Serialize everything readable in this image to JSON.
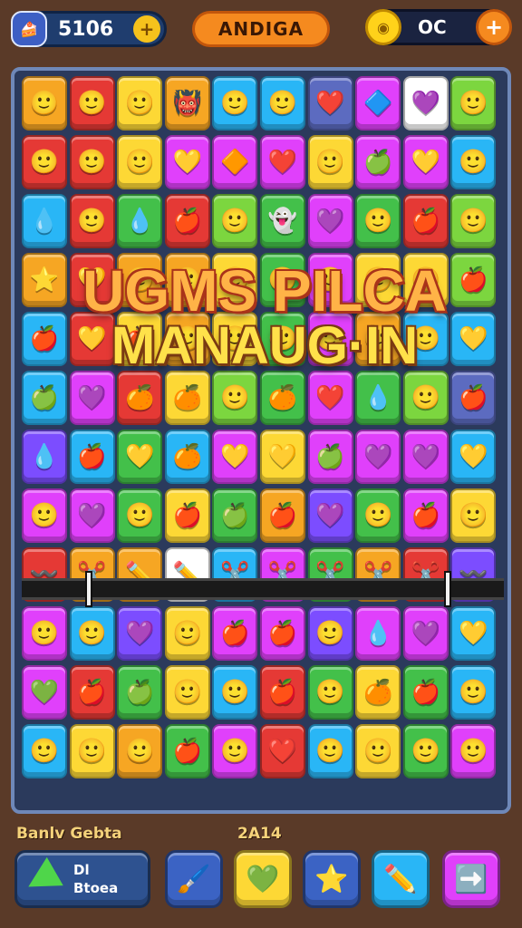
{
  "header": {
    "coins_value": "5106",
    "title_label": "ANDIGA",
    "lives_value": "OC",
    "coin_plus_label": "+",
    "lives_plus_label": "+"
  },
  "banner": {
    "line1": "UGMS PILCA",
    "line2": "MANAUG·IN"
  },
  "board": {
    "rows": [
      [
        [
          "#f6a623",
          "🙂"
        ],
        [
          "#e53935",
          "🙂"
        ],
        [
          "#fdd835",
          "🙂"
        ],
        [
          "#f6a623",
          "👹"
        ],
        [
          "#29b6f6",
          "🙂"
        ],
        [
          "#29b6f6",
          "🙂"
        ],
        [
          "#5c6bc0",
          "❤️"
        ],
        [
          "#e040fb",
          "🔷"
        ],
        [
          "#ffffff",
          "💜"
        ],
        [
          "#7cd63f",
          "🙂"
        ]
      ],
      [
        [
          "#e53935",
          "🙂"
        ],
        [
          "#e53935",
          "🙂"
        ],
        [
          "#fdd835",
          "🙂"
        ],
        [
          "#e040fb",
          "💛"
        ],
        [
          "#e040fb",
          "🔶"
        ],
        [
          "#e040fb",
          "❤️"
        ],
        [
          "#fdd835",
          "🙂"
        ],
        [
          "#e040fb",
          "🍏"
        ],
        [
          "#e040fb",
          "💛"
        ],
        [
          "#29b6f6",
          "🙂"
        ]
      ],
      [
        [
          "#29b6f6",
          "💧"
        ],
        [
          "#e53935",
          "🙂"
        ],
        [
          "#43c04a",
          "💧"
        ],
        [
          "#e53935",
          "🍎"
        ],
        [
          "#7cd63f",
          "🙂"
        ],
        [
          "#43c04a",
          "👻"
        ],
        [
          "#e040fb",
          "💜"
        ],
        [
          "#43c04a",
          "🙂"
        ],
        [
          "#e53935",
          "🍎"
        ],
        [
          "#7cd63f",
          "🙂"
        ]
      ],
      [
        [
          "#f6a623",
          "⭐"
        ],
        [
          "#e53935",
          "💛"
        ],
        [
          "#f6a623",
          "🙂"
        ],
        [
          "#f6a623",
          "🙂"
        ],
        [
          "#fdd835",
          "🙂"
        ],
        [
          "#43c04a",
          "🙂"
        ],
        [
          "#e040fb",
          "🙂"
        ],
        [
          "#fdd835",
          "🙂"
        ],
        [
          "#fdd835",
          "🙂"
        ],
        [
          "#7cd63f",
          "🍎"
        ]
      ],
      [
        [
          "#29b6f6",
          "🍎"
        ],
        [
          "#e53935",
          "💛"
        ],
        [
          "#fdd835",
          "🍎"
        ],
        [
          "#f6a623",
          "🙂"
        ],
        [
          "#fdd835",
          "🙂"
        ],
        [
          "#43c04a",
          "🙂"
        ],
        [
          "#e040fb",
          "🙂"
        ],
        [
          "#f6a623",
          "🙂"
        ],
        [
          "#29b6f6",
          "🙂"
        ],
        [
          "#29b6f6",
          "💛"
        ]
      ],
      [
        [
          "#29b6f6",
          "🍏"
        ],
        [
          "#e040fb",
          "💜"
        ],
        [
          "#e53935",
          "🍊"
        ],
        [
          "#fdd835",
          "🍊"
        ],
        [
          "#7cd63f",
          "🙂"
        ],
        [
          "#43c04a",
          "🍊"
        ],
        [
          "#e040fb",
          "❤️"
        ],
        [
          "#43c04a",
          "💧"
        ],
        [
          "#7cd63f",
          "🙂"
        ],
        [
          "#5c6bc0",
          "🍎"
        ]
      ],
      [
        [
          "#7c4dff",
          "💧"
        ],
        [
          "#29b6f6",
          "🍎"
        ],
        [
          "#43c04a",
          "💛"
        ],
        [
          "#29b6f6",
          "🍊"
        ],
        [
          "#e040fb",
          "💛"
        ],
        [
          "#fdd835",
          "💛"
        ],
        [
          "#e040fb",
          "🍏"
        ],
        [
          "#e040fb",
          "💜"
        ],
        [
          "#e040fb",
          "💜"
        ],
        [
          "#29b6f6",
          "💛"
        ]
      ],
      [
        [
          "#e040fb",
          "🙂"
        ],
        [
          "#e040fb",
          "💜"
        ],
        [
          "#43c04a",
          "🙂"
        ],
        [
          "#fdd835",
          "🍎"
        ],
        [
          "#43c04a",
          "🍏"
        ],
        [
          "#f6a623",
          "🍎"
        ],
        [
          "#7c4dff",
          "💜"
        ],
        [
          "#43c04a",
          "🙂"
        ],
        [
          "#e040fb",
          "🍎"
        ],
        [
          "#fdd835",
          "🙂"
        ]
      ],
      [
        [
          "#e53935",
          "〰️"
        ],
        [
          "#f6a623",
          "✂️"
        ],
        [
          "#f6a623",
          "✏️"
        ],
        [
          "#ffffff",
          "✏️"
        ],
        [
          "#29b6f6",
          "✂️"
        ],
        [
          "#e040fb",
          "✂️"
        ],
        [
          "#43c04a",
          "✂️"
        ],
        [
          "#f6a623",
          "✂️"
        ],
        [
          "#e53935",
          "✂️"
        ],
        [
          "#7c4dff",
          "〰️"
        ]
      ],
      [
        [
          "#e040fb",
          "🙂"
        ],
        [
          "#29b6f6",
          "🙂"
        ],
        [
          "#7c4dff",
          "💜"
        ],
        [
          "#fdd835",
          "🙂"
        ],
        [
          "#e040fb",
          "🍎"
        ],
        [
          "#e040fb",
          "🍎"
        ],
        [
          "#7c4dff",
          "🙂"
        ],
        [
          "#e040fb",
          "💧"
        ],
        [
          "#e040fb",
          "💜"
        ],
        [
          "#29b6f6",
          "💛"
        ]
      ],
      [
        [
          "#e040fb",
          "💚"
        ],
        [
          "#e53935",
          "🍎"
        ],
        [
          "#43c04a",
          "🍏"
        ],
        [
          "#fdd835",
          "🙂"
        ],
        [
          "#29b6f6",
          "🙂"
        ],
        [
          "#e53935",
          "🍎"
        ],
        [
          "#43c04a",
          "🙂"
        ],
        [
          "#fdd835",
          "🍊"
        ],
        [
          "#43c04a",
          "🍎"
        ],
        [
          "#29b6f6",
          "🙂"
        ]
      ],
      [
        [
          "#29b6f6",
          "🙂"
        ],
        [
          "#fdd835",
          "🙂"
        ],
        [
          "#f6a623",
          "🙂"
        ],
        [
          "#43c04a",
          "🍎"
        ],
        [
          "#e040fb",
          "🙂"
        ],
        [
          "#e53935",
          "❤️"
        ],
        [
          "#29b6f6",
          "🙂"
        ],
        [
          "#fdd835",
          "🙂"
        ],
        [
          "#43c04a",
          "🙂"
        ],
        [
          "#e040fb",
          "🙂"
        ]
      ]
    ]
  },
  "footer": {
    "label_left": "Banlv  Gebta",
    "label_mid": "2A14",
    "wide_button_line1": "Dl",
    "wide_button_line2": "Btoea",
    "buttons": [
      {
        "name": "brush-button",
        "color": "#3b63c4",
        "icon": "🖌️"
      },
      {
        "name": "heart-button",
        "color": "#fdd835",
        "icon": "💚"
      },
      {
        "name": "star-button",
        "color": "#3b63c4",
        "icon": "⭐"
      },
      {
        "name": "pencil-button",
        "color": "#29b6f6",
        "icon": "✏️"
      },
      {
        "name": "arrow-button",
        "color": "#e040fb",
        "icon": "➡️"
      }
    ]
  }
}
